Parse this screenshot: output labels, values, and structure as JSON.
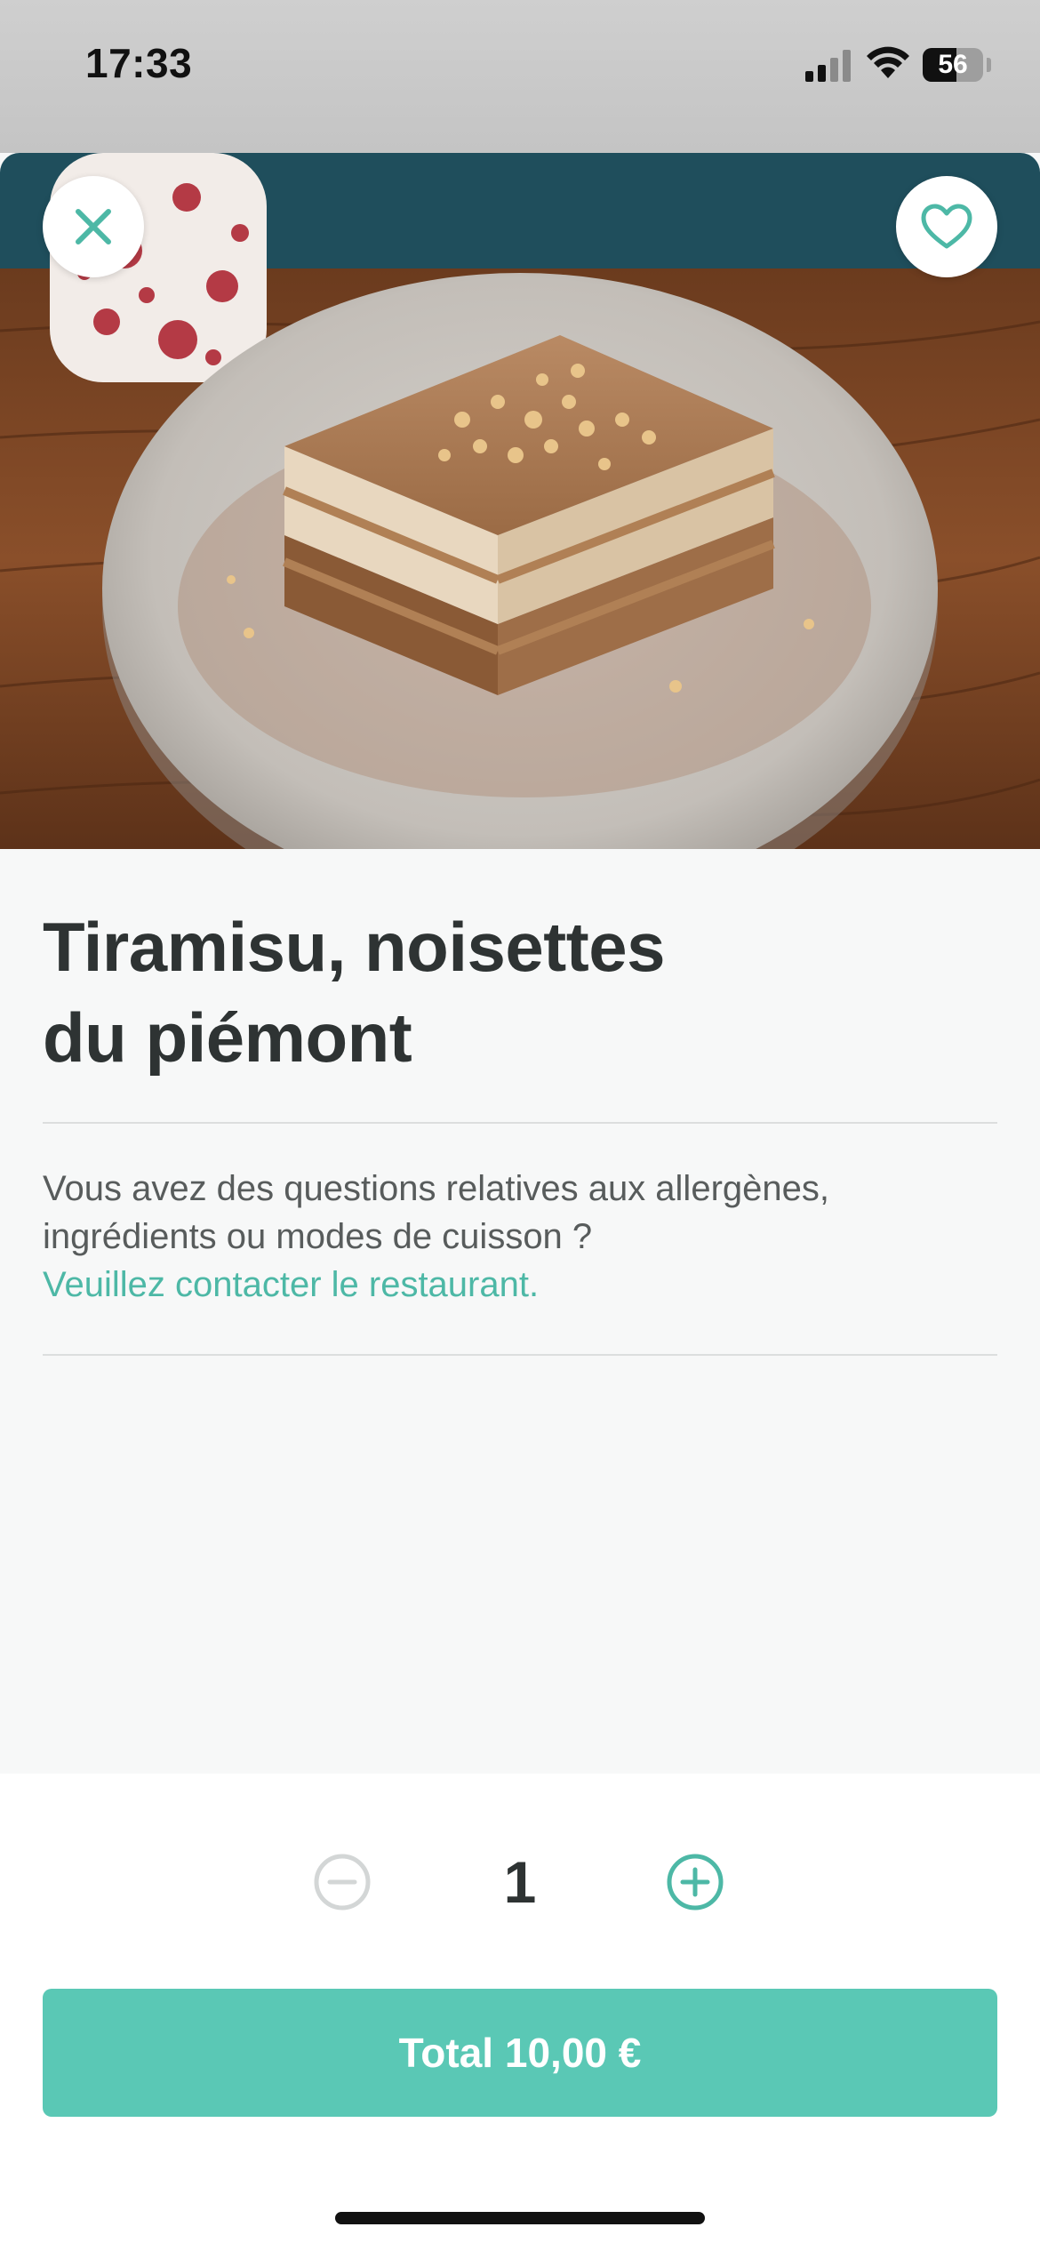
{
  "status_bar": {
    "time": "17:33",
    "battery_level": "56",
    "signal_bars_active": 2
  },
  "product": {
    "title_line1": "Tiramisu, noisettes",
    "title_line2": "du piémont"
  },
  "info": {
    "question_line1": "Vous avez des questions relatives aux allergènes,",
    "question_line2": "ingrédients ou modes de cuisson ?",
    "contact_link": "Veuillez contacter le restaurant."
  },
  "quantity": {
    "value": "1"
  },
  "checkout": {
    "total_label": "Total 10,00 €"
  },
  "icons": {
    "close": "close-icon",
    "favorite": "heart-icon",
    "decrease": "minus-circle-icon",
    "increase": "plus-circle-icon"
  },
  "colors": {
    "accent": "#4db8a6",
    "button": "#5ac8b5",
    "text": "#2e3333",
    "muted_text": "#585c5c"
  }
}
